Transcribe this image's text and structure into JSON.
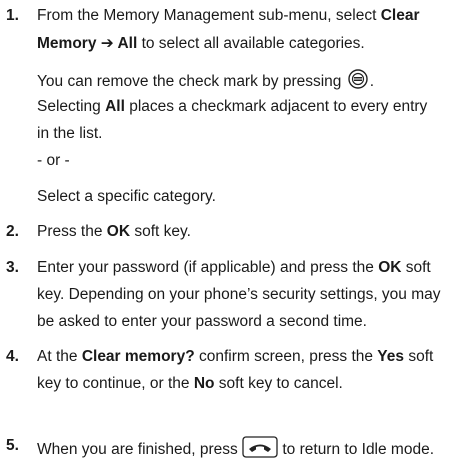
{
  "steps": [
    {
      "number": "1.",
      "l1_a": "From the Memory Management sub-menu, select ",
      "l1_bold": "Clear",
      "l2_bold": "Memory ➔ All",
      "l2_b": " to select all available categories.",
      "note1": "You can remove the check mark by pressing ",
      "note1_end": ".",
      "note2_a": "Selecting ",
      "note2_bold": "All",
      "note2_b": " places a checkmark adjacent to every entry",
      "note3": "in the list.",
      "or": "- or -",
      "alt": "Select a specific category."
    },
    {
      "number": "2.",
      "a": "Press the ",
      "bold": "OK",
      "b": " soft key."
    },
    {
      "number": "3.",
      "l1_a": "Enter your password (if applicable) and press the ",
      "l1_bold": "OK",
      "l1_b": " soft",
      "l2": "key. Depending on your phone’s security settings, you may",
      "l3": "be asked to enter your password a second time."
    },
    {
      "number": "4.",
      "l1_a": "At the ",
      "l1_bold1": "Clear memory?",
      "l1_b": " confirm screen, press the ",
      "l1_bold2": "Yes",
      "l1_c": " soft",
      "l2_a": "key to continue, or the ",
      "l2_bold": "No",
      "l2_b": " soft key to cancel."
    },
    {
      "number": "5.",
      "a": "When you are finished, press ",
      "b": " to return to Idle mode."
    }
  ]
}
